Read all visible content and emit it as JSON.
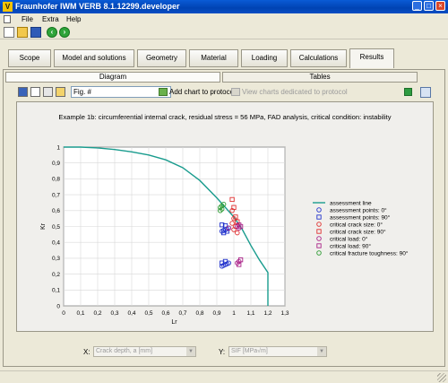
{
  "window": {
    "title": "Fraunhofer IWM VERB 8.1.12299.developer",
    "app_icon_text": "V",
    "controls": [
      "_",
      "□",
      "×"
    ]
  },
  "menu": [
    "File",
    "Extra",
    "Help"
  ],
  "tabs": [
    {
      "label": "Scope",
      "active": false
    },
    {
      "label": "Model and solutions",
      "active": false
    },
    {
      "label": "Geometry",
      "active": false
    },
    {
      "label": "Material",
      "active": false
    },
    {
      "label": "Loading",
      "active": false
    },
    {
      "label": "Calculations",
      "active": false
    },
    {
      "label": "Results",
      "active": true
    }
  ],
  "subtabs": [
    {
      "label": "Diagram",
      "active": true
    },
    {
      "label": "Tables",
      "active": false
    }
  ],
  "chart_toolbar": {
    "figure_value": "Fig. #",
    "add_chart_label": "Add chart to protocol",
    "view_charts_label": "View charts dedicated to protocol"
  },
  "axis_selectors": {
    "x_label": "X:",
    "x_value": "Crack depth, a [mm]",
    "y_label": "Y:",
    "y_value": "SIF [MPa√m]"
  },
  "chart_data": {
    "type": "scatter",
    "title": "Example 1b: circumferential internal crack, residual stress = 56 MPa, FAD analysis, critical condition: instability",
    "xlabel": "Lr",
    "ylabel": "Kr",
    "xlim": [
      0,
      1.3
    ],
    "ylim": [
      0,
      1
    ],
    "xticks": [
      "0",
      "0,1",
      "0,2",
      "0,3",
      "0,4",
      "0,5",
      "0,6",
      "0,7",
      "0,8",
      "0,9",
      "1",
      "1,1",
      "1,2",
      "1,3"
    ],
    "yticks": [
      "0",
      "0,1",
      "0,2",
      "0,3",
      "0,4",
      "0,5",
      "0,6",
      "0,7",
      "0,8",
      "0,9",
      "1"
    ],
    "grid": true,
    "legend_position": "right",
    "series": [
      {
        "name": "assessment line",
        "marker": "line",
        "color": "#1a9c8e",
        "points": [
          [
            0,
            1
          ],
          [
            0.1,
            1
          ],
          [
            0.2,
            0.995
          ],
          [
            0.3,
            0.985
          ],
          [
            0.4,
            0.97
          ],
          [
            0.5,
            0.95
          ],
          [
            0.6,
            0.92
          ],
          [
            0.7,
            0.87
          ],
          [
            0.8,
            0.79
          ],
          [
            0.9,
            0.68
          ],
          [
            1.0,
            0.56
          ],
          [
            1.05,
            0.48
          ],
          [
            1.1,
            0.38
          ],
          [
            1.15,
            0.29
          ],
          [
            1.2,
            0.21
          ],
          [
            1.2,
            0
          ]
        ]
      },
      {
        "name": "assessment points: 0°",
        "marker": "circle",
        "color": "#2233cc",
        "points": [
          [
            0.93,
            0.47
          ],
          [
            0.94,
            0.475
          ],
          [
            0.95,
            0.48
          ],
          [
            0.96,
            0.485
          ],
          [
            0.97,
            0.49
          ],
          [
            0.93,
            0.25
          ],
          [
            0.94,
            0.255
          ],
          [
            0.95,
            0.26
          ],
          [
            0.96,
            0.265
          ],
          [
            0.97,
            0.27
          ]
        ]
      },
      {
        "name": "assessment points: 90°",
        "marker": "square",
        "color": "#2233cc",
        "points": [
          [
            0.93,
            0.51
          ],
          [
            0.95,
            0.505
          ],
          [
            0.94,
            0.46
          ],
          [
            0.96,
            0.47
          ],
          [
            0.93,
            0.27
          ],
          [
            0.95,
            0.28
          ]
        ]
      },
      {
        "name": "critical crack size: 0°",
        "marker": "circle",
        "color": "#e03030",
        "points": [
          [
            0.99,
            0.6
          ],
          [
            1.0,
            0.55
          ],
          [
            1.01,
            0.5
          ],
          [
            1.02,
            0.46
          ],
          [
            0.99,
            0.52
          ],
          [
            1.0,
            0.48
          ]
        ]
      },
      {
        "name": "critical crack size: 90°",
        "marker": "square",
        "color": "#e03030",
        "points": [
          [
            0.99,
            0.67
          ],
          [
            1.0,
            0.62
          ],
          [
            1.01,
            0.56
          ],
          [
            1.02,
            0.53
          ]
        ]
      },
      {
        "name": "critical load: 0°",
        "marker": "circle",
        "color": "#aa2288",
        "points": [
          [
            0.97,
            0.49
          ],
          [
            1.02,
            0.5
          ],
          [
            1.03,
            0.49
          ],
          [
            1.02,
            0.27
          ],
          [
            1.03,
            0.28
          ]
        ]
      },
      {
        "name": "critical load: 90°",
        "marker": "square",
        "color": "#aa2288",
        "points": [
          [
            1.03,
            0.51
          ],
          [
            1.04,
            0.5
          ],
          [
            1.03,
            0.26
          ],
          [
            1.04,
            0.29
          ]
        ]
      },
      {
        "name": "critical fracture toughness: 90°",
        "marker": "circle",
        "color": "#2a9a30",
        "points": [
          [
            0.92,
            0.62
          ],
          [
            0.93,
            0.63
          ],
          [
            0.94,
            0.64
          ],
          [
            0.93,
            0.61
          ],
          [
            0.92,
            0.6
          ]
        ]
      }
    ]
  }
}
